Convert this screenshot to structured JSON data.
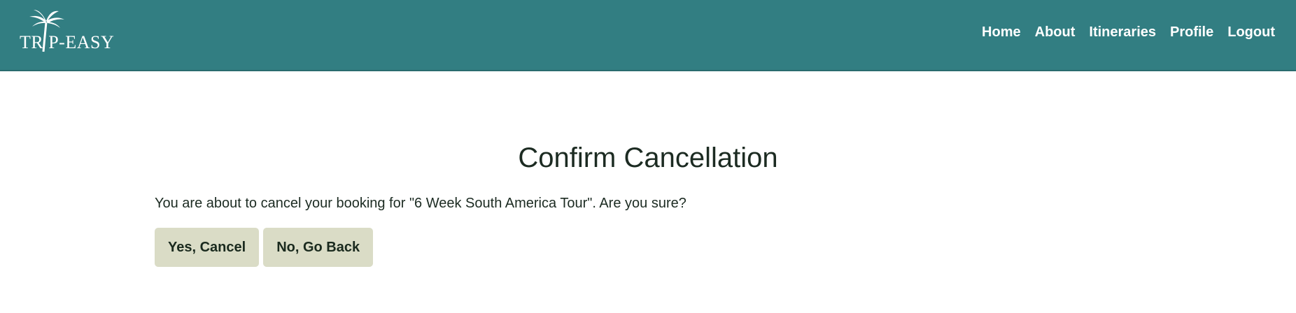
{
  "header": {
    "logo_text": "TR P-EASY",
    "logo_icon": "palm-tree-icon",
    "nav": [
      {
        "label": "Home"
      },
      {
        "label": "About"
      },
      {
        "label": "Itineraries"
      },
      {
        "label": "Profile"
      },
      {
        "label": "Logout"
      }
    ]
  },
  "main": {
    "title": "Confirm Cancellation",
    "message": "You are about to cancel your booking for \"6 Week South America Tour\". Are you sure?",
    "confirm_label": "Yes, Cancel",
    "back_label": "No, Go Back"
  },
  "colors": {
    "header_bg": "#327e82",
    "button_bg": "#dadcc6",
    "text": "#1c2b22"
  }
}
